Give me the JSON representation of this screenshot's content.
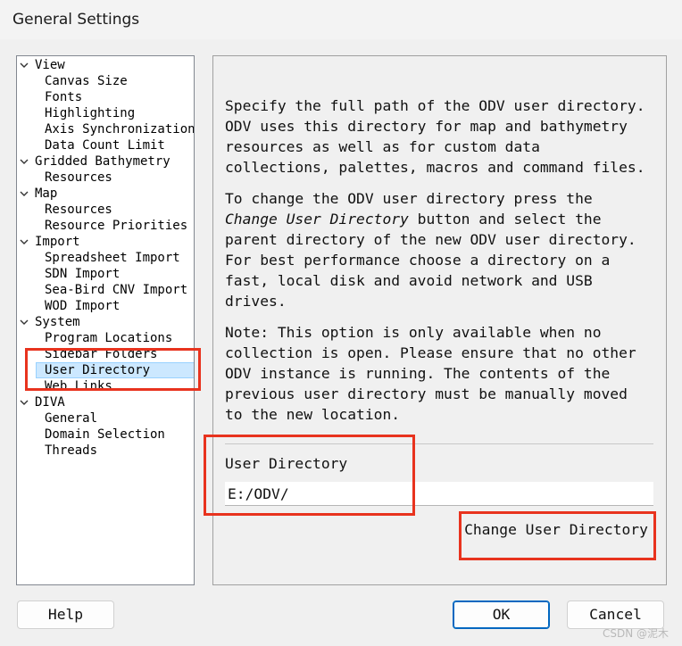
{
  "window": {
    "title": "General Settings"
  },
  "tree": {
    "items": [
      {
        "label": "View",
        "level": 0,
        "expanded": true
      },
      {
        "label": "Canvas Size",
        "level": 1
      },
      {
        "label": "Fonts",
        "level": 1
      },
      {
        "label": "Highlighting",
        "level": 1
      },
      {
        "label": "Axis Synchronization",
        "level": 1
      },
      {
        "label": "Data Count Limit",
        "level": 1
      },
      {
        "label": "Gridded Bathymetry",
        "level": 0,
        "expanded": true
      },
      {
        "label": "Resources",
        "level": 1
      },
      {
        "label": "Map",
        "level": 0,
        "expanded": true
      },
      {
        "label": "Resources",
        "level": 1
      },
      {
        "label": "Resource Priorities",
        "level": 1
      },
      {
        "label": "Import",
        "level": 0,
        "expanded": true
      },
      {
        "label": "Spreadsheet Import",
        "level": 1
      },
      {
        "label": "SDN Import",
        "level": 1
      },
      {
        "label": "Sea-Bird CNV Import",
        "level": 1
      },
      {
        "label": "WOD Import",
        "level": 1
      },
      {
        "label": "System",
        "level": 0,
        "expanded": true
      },
      {
        "label": "Program Locations",
        "level": 1
      },
      {
        "label": "Sidebar Folders",
        "level": 1
      },
      {
        "label": "User Directory",
        "level": 1,
        "selected": true
      },
      {
        "label": "Web Links",
        "level": 1
      },
      {
        "label": "DIVA",
        "level": 0,
        "expanded": true
      },
      {
        "label": "General",
        "level": 1
      },
      {
        "label": "Domain Selection",
        "level": 1
      },
      {
        "label": "Threads",
        "level": 1
      }
    ]
  },
  "panel": {
    "para1": "Specify the full path of the ODV user directory.\nODV uses this directory for map and bathymetry\nresources as well as for custom data\ncollections, palettes, macros and command files.",
    "para2_prefix": "To change the ODV user directory press the",
    "para2_emph": "Change User Directory",
    "para2_rest": " button and select the",
    "para2_tail": "parent directory of the new ODV user directory.\nFor best performance choose a directory on a\nfast, local disk and avoid network and USB\ndrives.",
    "para3": "Note: This option is only available when no\ncollection is open. Please ensure that no other\nODV instance is running. The contents of the\nprevious user directory must be manually moved\nto the new location.",
    "field_label": "User Directory",
    "field_value": "E:/ODV/",
    "change_button": "Change User Directory"
  },
  "buttons": {
    "help": "Help",
    "ok": "OK",
    "cancel": "Cancel"
  },
  "watermark": "CSDN @泥木",
  "colors": {
    "annotation": "#e8331e",
    "selection_bg": "#cce8ff",
    "ok_border": "#0067c0"
  }
}
